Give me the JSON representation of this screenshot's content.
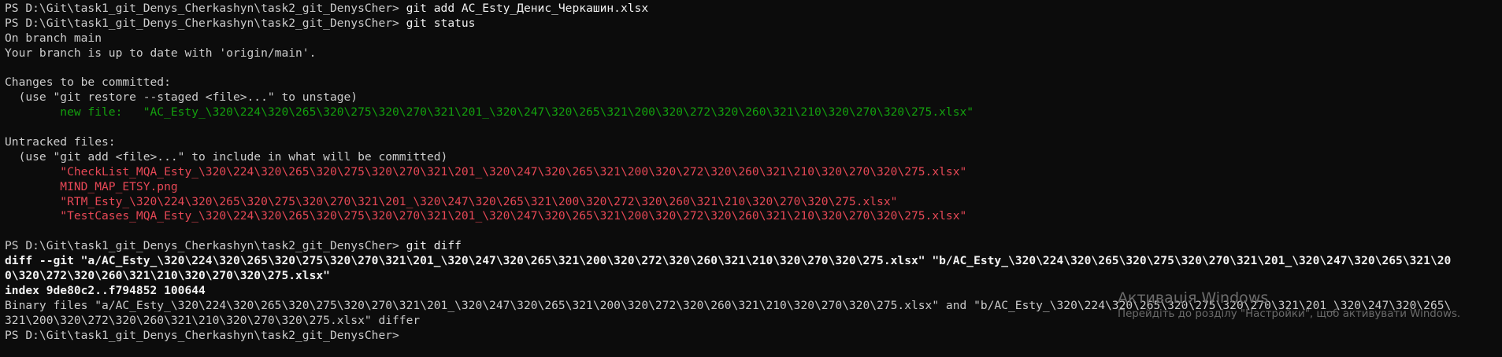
{
  "terminal": {
    "colors": {
      "background": "#0c0c0c",
      "text": "#cccccc",
      "staged": "#13a10e",
      "untracked": "#e74856"
    },
    "prompt": "PS D:\\Git\\task1_git_Denys_Cherkashyn\\task2_git_DenysCher>",
    "cmd1": " git add AC_Esty_Денис_Черкашин.xlsx",
    "cmd2": " git status",
    "branch_line": "On branch main",
    "uptodate_line": "Your branch is up to date with 'origin/main'.",
    "staged_header": "Changes to be committed:",
    "staged_hint": "  (use \"git restore --staged <file>...\" to unstage)",
    "staged_entry": "        new file:   \"AC_Esty_\\320\\224\\320\\265\\320\\275\\320\\270\\321\\201_\\320\\247\\320\\265\\321\\200\\320\\272\\320\\260\\321\\210\\320\\270\\320\\275.xlsx\"",
    "untracked_header": "Untracked files:",
    "untracked_hint": "  (use \"git add <file>...\" to include in what will be committed)",
    "untracked_files": [
      "        \"CheckList_MQA_Esty_\\320\\224\\320\\265\\320\\275\\320\\270\\321\\201_\\320\\247\\320\\265\\321\\200\\320\\272\\320\\260\\321\\210\\320\\270\\320\\275.xlsx\"",
      "        MIND_MAP_ETSY.png",
      "        \"RTM_Esty_\\320\\224\\320\\265\\320\\275\\320\\270\\321\\201_\\320\\247\\320\\265\\321\\200\\320\\272\\320\\260\\321\\210\\320\\270\\320\\275.xlsx\"",
      "        \"TestCases_MQA_Esty_\\320\\224\\320\\265\\320\\275\\320\\270\\321\\201_\\320\\247\\320\\265\\321\\200\\320\\272\\320\\260\\321\\210\\320\\270\\320\\275.xlsx\""
    ],
    "cmd3": " git diff",
    "diff_line1": "diff --git \"a/AC_Esty_\\320\\224\\320\\265\\320\\275\\320\\270\\321\\201_\\320\\247\\320\\265\\321\\200\\320\\272\\320\\260\\321\\210\\320\\270\\320\\275.xlsx\" \"b/AC_Esty_\\320\\224\\320\\265\\320\\275\\320\\270\\321\\201_\\320\\247\\320\\265\\321\\20",
    "diff_line2": "0\\320\\272\\320\\260\\321\\210\\320\\270\\320\\275.xlsx\"",
    "index_line": "index 9de80c2..f794852 100644",
    "binary_line1": "Binary files \"a/AC_Esty_\\320\\224\\320\\265\\320\\275\\320\\270\\321\\201_\\320\\247\\320\\265\\321\\200\\320\\272\\320\\260\\321\\210\\320\\270\\320\\275.xlsx\" and \"b/AC_Esty_\\320\\224\\320\\265\\320\\275\\320\\270\\321\\201_\\320\\247\\320\\265\\",
    "binary_line2": "321\\200\\320\\272\\320\\260\\321\\210\\320\\270\\320\\275.xlsx\" differ"
  },
  "watermark": {
    "title": "Активація Windows",
    "subtitle": "Перейдіть до розділу \"Настройки\", щоб активувати Windows."
  }
}
